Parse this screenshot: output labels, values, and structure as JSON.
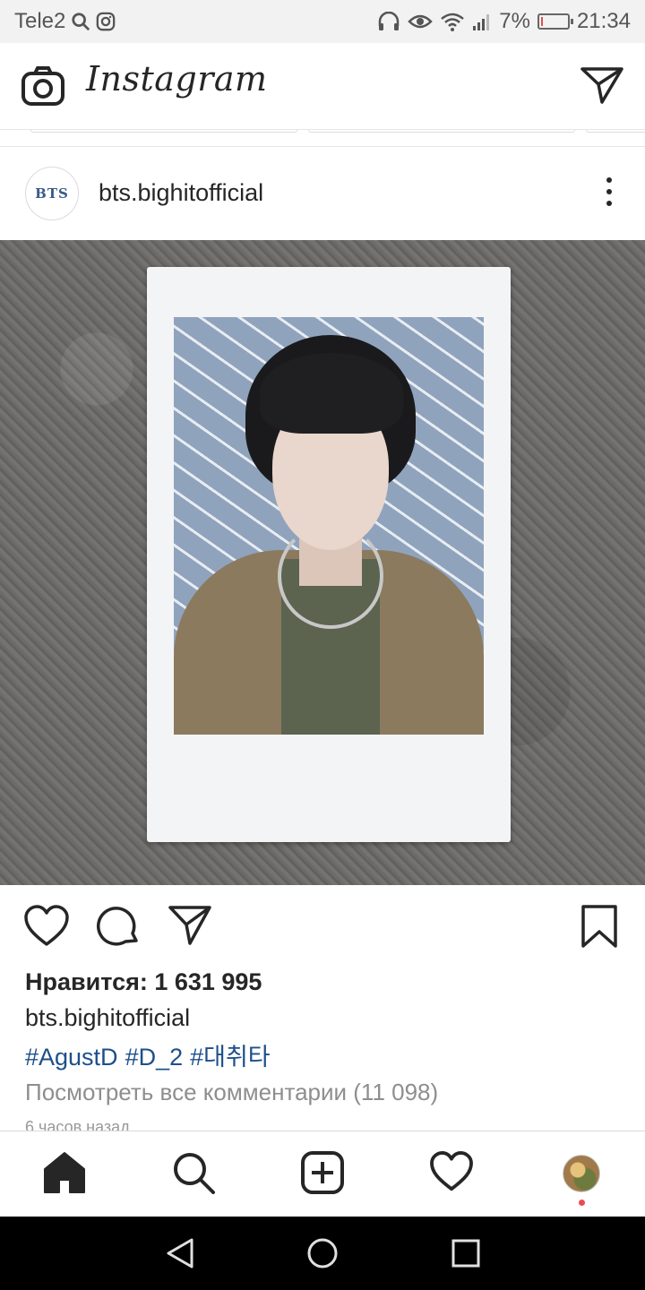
{
  "status_bar": {
    "carrier": "Tele2",
    "battery": "7%",
    "battery_level": 0.07,
    "time": "21:34",
    "icons": [
      "search-icon",
      "instagram-icon",
      "headphones-icon",
      "eye-icon",
      "wifi-icon",
      "signal-icon",
      "battery-icon"
    ]
  },
  "header": {
    "logo": "Instagram",
    "icons": [
      "camera-icon",
      "direct-send-icon"
    ]
  },
  "post": {
    "avatar_text": "BTS",
    "username": "bts.bighitofficial",
    "likes": "Нравится: 1 631 995",
    "caption_user": "bts.bighitofficial",
    "hashtags": [
      "#AgustD",
      "#D_2",
      "#대취타"
    ],
    "view_comments": "Посмотреть все комментарии (11 098)",
    "time_ago": "6 часов назад",
    "action_icons": [
      "heart-icon",
      "comment-icon",
      "share-icon",
      "bookmark-icon"
    ]
  },
  "bottom_nav": {
    "items": [
      "home-icon",
      "search-icon",
      "add-post-icon",
      "activity-heart-icon",
      "profile-avatar"
    ]
  },
  "system_nav": {
    "items": [
      "back-icon",
      "home-circle-icon",
      "recents-icon"
    ]
  }
}
